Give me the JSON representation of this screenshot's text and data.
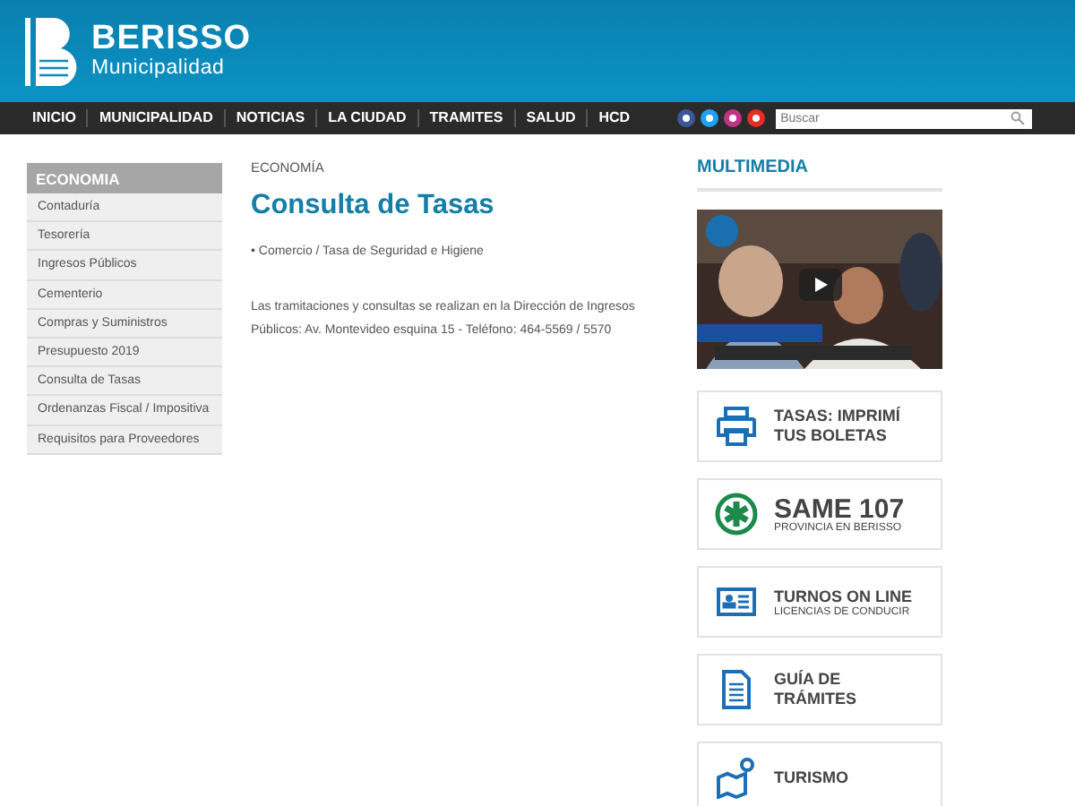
{
  "logo": {
    "name": "BERISSO",
    "subtitle": "Municipalidad"
  },
  "nav": [
    "INICIO",
    "MUNICIPALIDAD",
    "NOTICIAS",
    "LA CIUDAD",
    "TRAMITES",
    "SALUD",
    "HCD"
  ],
  "search": {
    "placeholder": "Buscar"
  },
  "sidebar": {
    "title": "ECONOMIA",
    "items": [
      "Contaduría",
      "Tesorería",
      "Ingresos Públicos",
      "Cementerio",
      "Compras y Suministros",
      "Presupuesto 2019",
      "Consulta de Tasas",
      "Ordenanzas Fiscal / Impositiva",
      "Requisitos para Proveedores"
    ]
  },
  "breadcrumb": "ECONOMÍA",
  "title": "Consulta de Tasas",
  "links": [
    "• Comercio / Tasa de Seguridad e Higiene"
  ],
  "paragraph": "Las tramitaciones y consultas se realizan en la Dirección de Ingresos Públicos: Av. Montevideo esquina 15 - Teléfono: 464-5569 / 5570",
  "multimedia": {
    "title": "MULTIMEDIA"
  },
  "cards": [
    {
      "kind": "plain",
      "title": "TASAS: IMPRIMÍ TUS BOLETAS"
    },
    {
      "kind": "big",
      "title": "SAME 107",
      "subtitle": "PROVINCIA EN BERISSO"
    },
    {
      "kind": "plain",
      "title": "TURNOS ON LINE",
      "subtitle": "LICENCIAS DE CONDUCIR"
    },
    {
      "kind": "plain",
      "title": "GUÍA DE TRÁMITES"
    },
    {
      "kind": "plain",
      "title": "TURISMO"
    }
  ]
}
